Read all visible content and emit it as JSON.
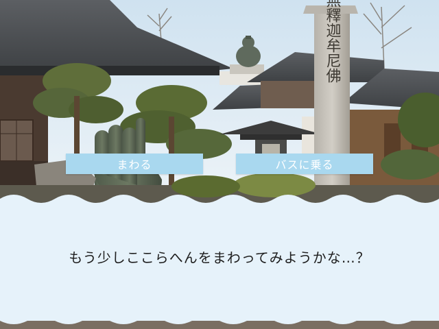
{
  "scene": {
    "description_icons": [
      "temple-icon",
      "buddha-statue-icon",
      "stone-pillar-icon",
      "lantern-icon",
      "pine-tree-icon",
      "hand-statue-icon"
    ],
    "colors": {
      "sky": "#dce9f2",
      "message_box": "#e6f2fa",
      "choice_button": "#a9d8ef",
      "choice_text": "#ffffff",
      "dialogue_text": "#1e1e1e"
    }
  },
  "choices": [
    {
      "label": "まわる"
    },
    {
      "label": "バスに乗る"
    }
  ],
  "message": {
    "text": "もう少しここらへんをまわってみようかな…？"
  },
  "pillar": {
    "inscription": "南無釋迦牟尼佛"
  }
}
